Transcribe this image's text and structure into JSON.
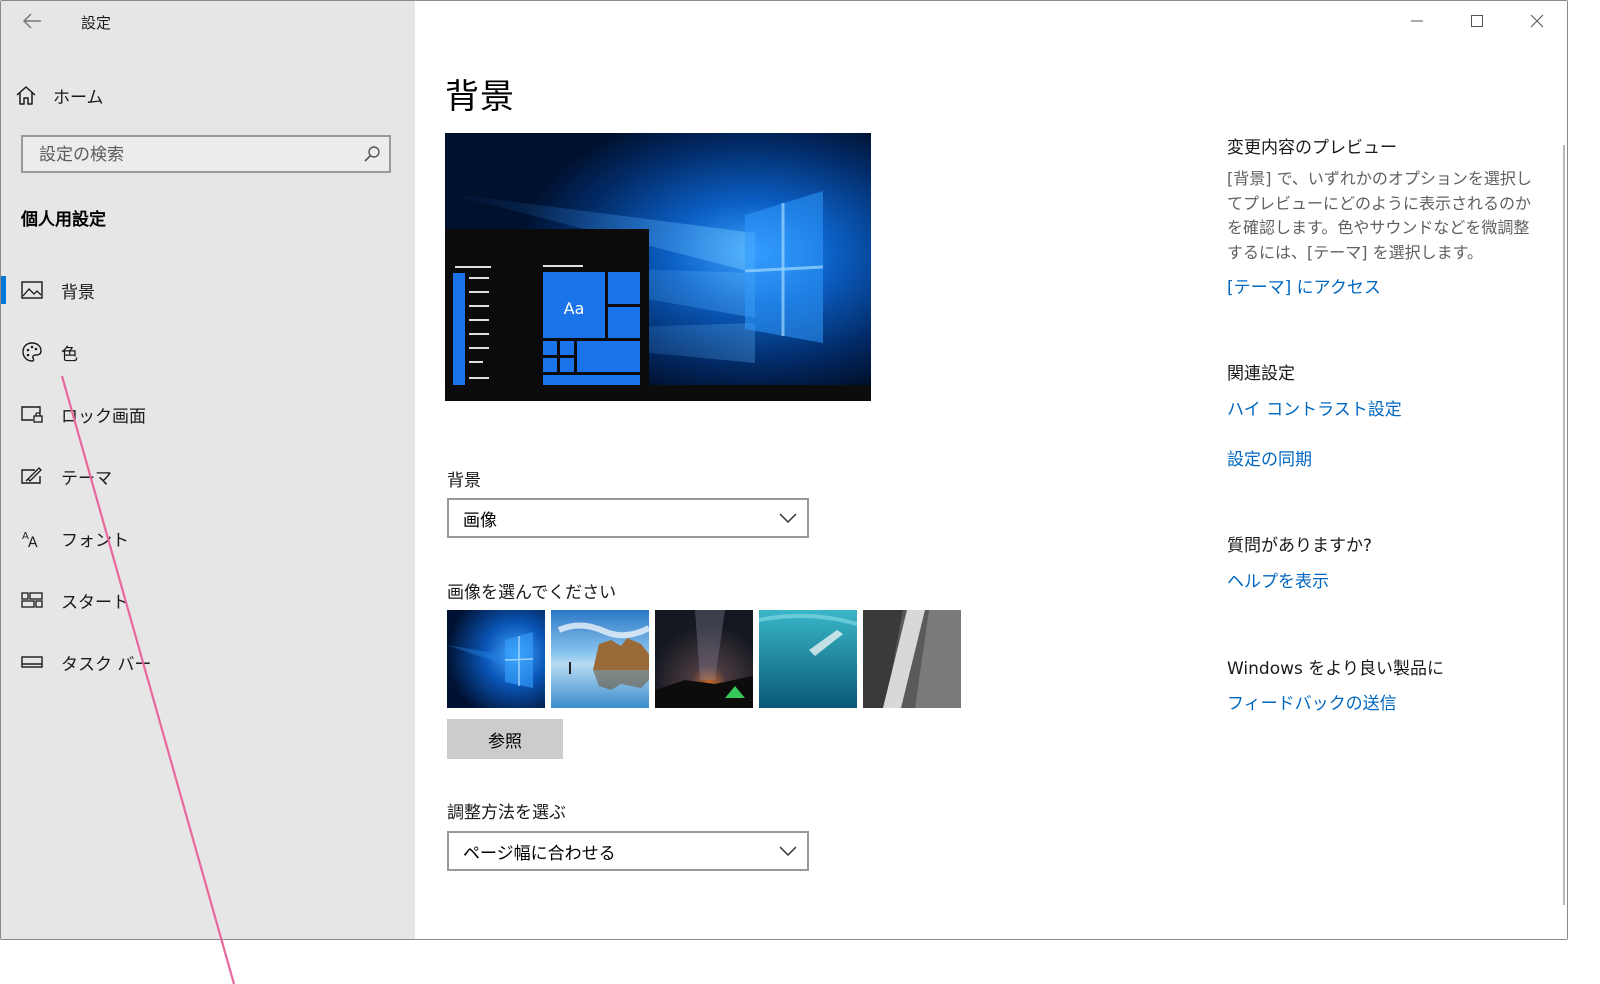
{
  "window": {
    "title": "設定"
  },
  "sidebar": {
    "home_label": "ホーム",
    "search_placeholder": "設定の検索",
    "section_title": "個人用設定",
    "items": [
      {
        "label": "背景",
        "icon": "picture-icon",
        "active": true
      },
      {
        "label": "色",
        "icon": "palette-icon",
        "active": false
      },
      {
        "label": "ロック画面",
        "icon": "lock-screen-icon",
        "active": false
      },
      {
        "label": "テーマ",
        "icon": "theme-icon",
        "active": false
      },
      {
        "label": "フォント",
        "icon": "font-icon",
        "active": false
      },
      {
        "label": "スタート",
        "icon": "start-icon",
        "active": false
      },
      {
        "label": "タスク バー",
        "icon": "taskbar-icon",
        "active": false
      }
    ]
  },
  "main": {
    "page_title": "背景",
    "preview_sample_text": "Aa",
    "background_label": "背景",
    "background_value": "画像",
    "choose_image_label": "画像を選んでください",
    "browse_label": "参照",
    "fit_label": "調整方法を選ぶ",
    "fit_value": "ページ幅に合わせる"
  },
  "right_panel": {
    "preview_heading": "変更内容のプレビュー",
    "preview_text": "[背景] で、いずれかのオプションを選択してプレビューにどのように表示されるのかを確認します。色やサウンドなどを微調整するには、[テーマ] を選択します。",
    "themes_link": "[テーマ] にアクセス",
    "related_heading": "関連設定",
    "high_contrast_link": "ハイ コントラスト設定",
    "sync_link": "設定の同期",
    "question_heading": "質問がありますか?",
    "help_link": "ヘルプを表示",
    "windows_heading": "Windows をより良い製品に",
    "feedback_link": "フィードバックの送信"
  },
  "colors": {
    "accent": "#0078d7",
    "link": "#0067c0",
    "sidebar_bg": "#e6e6e6",
    "annotation": "#e8679c"
  }
}
